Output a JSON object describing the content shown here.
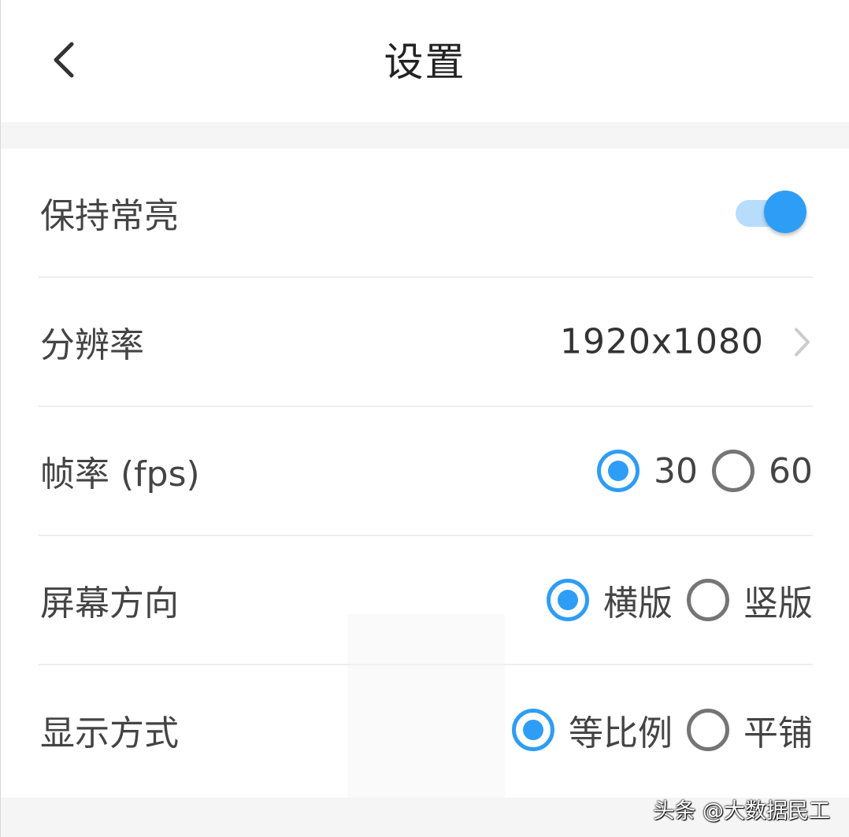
{
  "header": {
    "title": "设置",
    "back_icon": "chevron-left-icon"
  },
  "settings": {
    "keep_screen_on": {
      "label": "保持常亮",
      "enabled": true
    },
    "resolution": {
      "label": "分辨率",
      "value": "1920x1080",
      "chevron_icon": "chevron-right-icon"
    },
    "frame_rate": {
      "label": "帧率 (fps)",
      "options": [
        "30",
        "60"
      ],
      "selected": "30"
    },
    "orientation": {
      "label": "屏幕方向",
      "options": [
        "横版",
        "竖版"
      ],
      "selected": "横版"
    },
    "display_mode": {
      "label": "显示方式",
      "options": [
        "等比例",
        "平铺"
      ],
      "selected": "等比例"
    }
  },
  "watermark": "头条 @大数据民工",
  "colors": {
    "accent": "#2e9df6",
    "toggle_track": "#b8dcfb",
    "radio_unchecked": "#757575",
    "divider": "#eeeeee",
    "band": "#f5f5f5"
  }
}
